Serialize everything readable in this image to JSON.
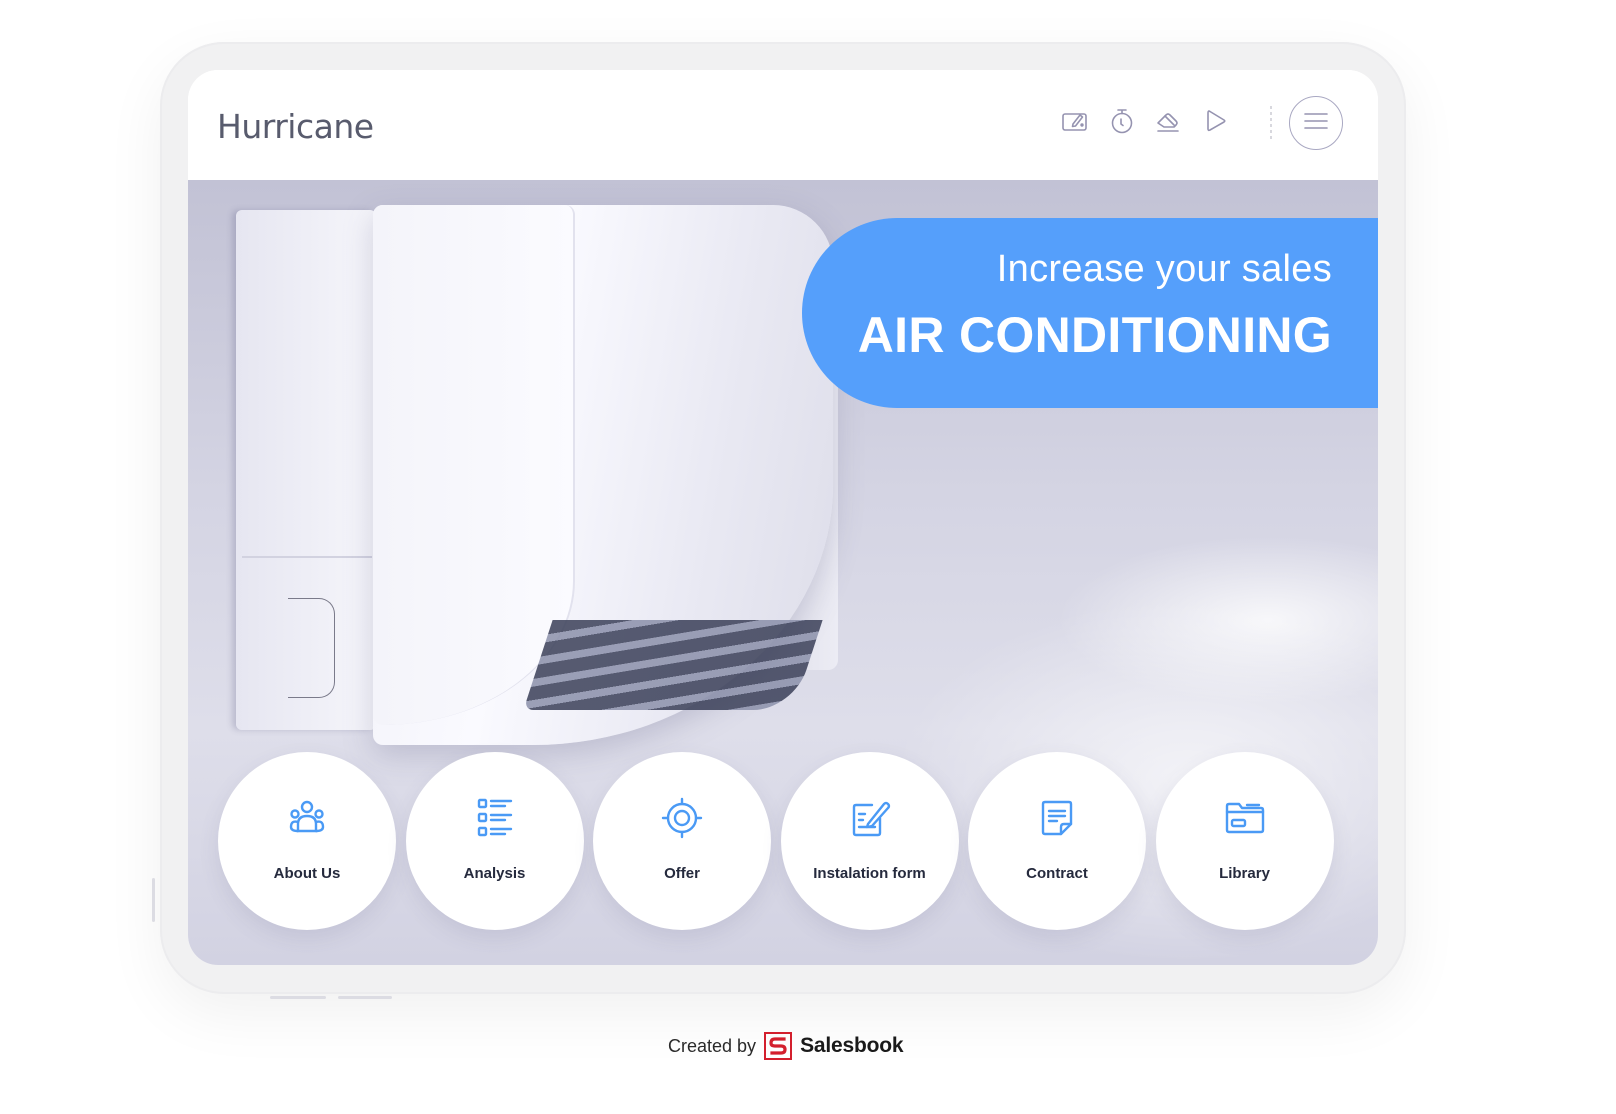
{
  "header": {
    "brand": "Hurricane",
    "tools": [
      {
        "name": "notes-icon",
        "label": "Notes"
      },
      {
        "name": "stopwatch-icon",
        "label": "Timer"
      },
      {
        "name": "eraser-icon",
        "label": "Eraser"
      },
      {
        "name": "play-icon",
        "label": "Present"
      }
    ],
    "menu_icon": "hamburger-icon"
  },
  "hero": {
    "subtitle": "Increase your sales",
    "title": "AIR CONDITIONING",
    "banner_color": "#559ffb"
  },
  "nav": {
    "icon_color": "#4a9af5",
    "items": [
      {
        "label": "About Us",
        "icon": "team-icon"
      },
      {
        "label": "Analysis",
        "icon": "checklist-icon"
      },
      {
        "label": "Offer",
        "icon": "target-icon"
      },
      {
        "label": "Instalation form",
        "icon": "edit-form-icon"
      },
      {
        "label": "Contract",
        "icon": "document-icon"
      },
      {
        "label": "Library",
        "icon": "folder-icon"
      }
    ]
  },
  "footer": {
    "created_by": "Created by",
    "brand": "Salesbook",
    "brand_color": "#d31f2d"
  }
}
